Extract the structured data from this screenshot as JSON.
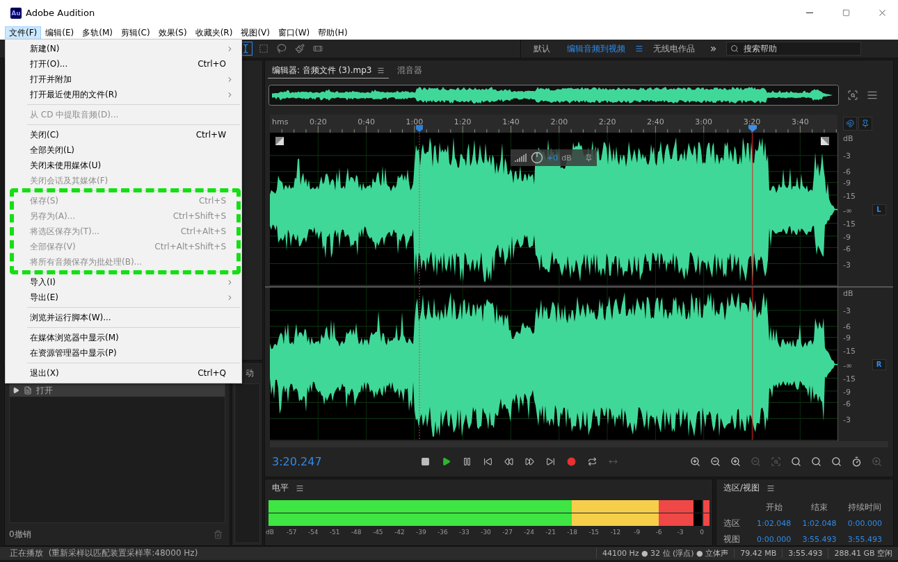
{
  "window": {
    "app_badge": "Au",
    "title": "Adobe Audition"
  },
  "menu_bar": [
    {
      "label": "文件(F)",
      "selected": true
    },
    {
      "label": "编辑(E)",
      "selected": false
    },
    {
      "label": "多轨(M)",
      "selected": false
    },
    {
      "label": "剪辑(C)",
      "selected": false
    },
    {
      "label": "效果(S)",
      "selected": false
    },
    {
      "label": "收藏夹(R)",
      "selected": false
    },
    {
      "label": "视图(V)",
      "selected": false
    },
    {
      "label": "窗口(W)",
      "selected": false
    },
    {
      "label": "帮助(H)",
      "selected": false
    }
  ],
  "file_menu": {
    "sections": [
      {
        "highlighted": false,
        "items": [
          {
            "label": "新建(N)",
            "submenu": true,
            "disabled": false
          },
          {
            "label": "打开(O)...",
            "shortcut": "Ctrl+O",
            "submenu": false,
            "disabled": false
          },
          {
            "label": "打开并附加",
            "submenu": true,
            "disabled": false
          },
          {
            "label": "打开最近使用的文件(R)",
            "submenu": true,
            "disabled": false
          }
        ]
      },
      {
        "highlighted": false,
        "items": [
          {
            "label": "从 CD 中提取音频(D)...",
            "submenu": false,
            "disabled": true
          }
        ]
      },
      {
        "highlighted": false,
        "items": [
          {
            "label": "关闭(C)",
            "shortcut": "Ctrl+W",
            "submenu": false,
            "disabled": false
          },
          {
            "label": "全部关闭(L)",
            "submenu": false,
            "disabled": false
          },
          {
            "label": "关闭未使用媒体(U)",
            "submenu": false,
            "disabled": false
          },
          {
            "label": "关闭会话及其媒体(F)",
            "submenu": false,
            "disabled": true
          }
        ]
      },
      {
        "highlighted": true,
        "items": [
          {
            "label": "保存(S)",
            "shortcut": "Ctrl+S",
            "submenu": false,
            "disabled": true
          },
          {
            "label": "另存为(A)...",
            "shortcut": "Ctrl+Shift+S",
            "submenu": false,
            "disabled": true
          },
          {
            "label": "将选区保存为(T)...",
            "shortcut": "Ctrl+Alt+S",
            "submenu": false,
            "disabled": true
          },
          {
            "label": "全部保存(V)",
            "shortcut": "Ctrl+Alt+Shift+S",
            "submenu": false,
            "disabled": true
          },
          {
            "label": "将所有音频保存为批处理(B)...",
            "submenu": false,
            "disabled": true
          }
        ]
      },
      {
        "highlighted": false,
        "items": [
          {
            "label": "导入(I)",
            "submenu": true,
            "disabled": false
          },
          {
            "label": "导出(E)",
            "submenu": true,
            "disabled": false
          }
        ]
      },
      {
        "highlighted": false,
        "items": [
          {
            "label": "浏览并运行脚本(W)...",
            "submenu": false,
            "disabled": false
          }
        ]
      },
      {
        "highlighted": false,
        "items": [
          {
            "label": "在媒体浏览器中显示(M)",
            "submenu": false,
            "disabled": false
          },
          {
            "label": "在资源管理器中显示(P)",
            "submenu": false,
            "disabled": false
          }
        ]
      },
      {
        "highlighted": false,
        "items": [
          {
            "label": "退出(X)",
            "shortcut": "Ctrl+Q",
            "submenu": false,
            "disabled": false
          }
        ]
      }
    ]
  },
  "tools": [
    {
      "kind": "time-selection",
      "selected": true
    },
    {
      "kind": "marquee",
      "selected": false
    },
    {
      "kind": "lasso",
      "selected": false
    },
    {
      "kind": "brush",
      "selected": false
    },
    {
      "kind": "healing",
      "selected": false
    }
  ],
  "workspaces": [
    {
      "label": "默认",
      "selected": false
    },
    {
      "label": "编辑音频到视频",
      "selected": true
    },
    {
      "label": "无线电作品",
      "selected": false
    }
  ],
  "more_workspaces": "»",
  "search": {
    "placeholder": "搜索帮助"
  },
  "editor_tabs": [
    {
      "label": "编辑器: 音频文件 (3).mp3",
      "selected": true
    },
    {
      "label": "混音器",
      "selected": false
    }
  ],
  "ruler": {
    "unit": "hms",
    "labels": [
      "0:20",
      "0:40",
      "1:00",
      "1:20",
      "1:40",
      "2:00",
      "2:20",
      "2:40",
      "3:00",
      "3:20",
      "3:40"
    ]
  },
  "channels": [
    {
      "label": "L",
      "scale": [
        "dB",
        "-3",
        "-6",
        "-9",
        "-15",
        "-∞",
        "-15",
        "-9",
        "-6",
        "-3"
      ]
    },
    {
      "label": "R",
      "scale": [
        "dB",
        "-3",
        "-6",
        "-9",
        "-15",
        "-∞",
        "-15",
        "-9",
        "-6",
        "-3"
      ]
    }
  ],
  "hud": {
    "value": "+0",
    "unit": "dB"
  },
  "time_display": "3:20.247",
  "transport": [
    {
      "kind": "stop"
    },
    {
      "kind": "play"
    },
    {
      "kind": "pause"
    },
    {
      "kind": "to-start"
    },
    {
      "kind": "rewind"
    },
    {
      "kind": "fast-forward"
    },
    {
      "kind": "to-end"
    },
    {
      "kind": "record"
    },
    {
      "kind": "loop"
    },
    {
      "kind": "skip-selection"
    }
  ],
  "zoom_tools": [
    {
      "kind": "zoom-in-amplitude",
      "disabled": false
    },
    {
      "kind": "zoom-out-amplitude",
      "disabled": false
    },
    {
      "kind": "zoom-in-time",
      "disabled": false
    },
    {
      "kind": "zoom-out-time",
      "disabled": true
    },
    {
      "kind": "zoom-out-full",
      "disabled": true
    },
    {
      "kind": "zoom-selection-in",
      "disabled": false
    },
    {
      "kind": "zoom-selection-out",
      "disabled": false
    },
    {
      "kind": "zoom-to-selection",
      "disabled": false
    },
    {
      "kind": "zoom-playhead",
      "disabled": false
    },
    {
      "kind": "zoom-reset",
      "disabled": true
    }
  ],
  "level_panel": {
    "title": "电平",
    "meters": [
      {
        "level": 0.98
      },
      {
        "level": 0.98
      }
    ],
    "scale": [
      "dB",
      "-57",
      "-54",
      "-51",
      "-48",
      "-45",
      "-42",
      "-39",
      "-36",
      "-33",
      "-30",
      "-27",
      "-24",
      "-21",
      "-18",
      "-15",
      "-12",
      "-9",
      "-6",
      "-3",
      "0"
    ]
  },
  "selection_panel": {
    "title": "选区/视图",
    "columns": [
      "开始",
      "结束",
      "持续时间"
    ],
    "rows": [
      {
        "label": "选区",
        "values": [
          "1:02.048",
          "1:02.048",
          "0:00.000"
        ]
      },
      {
        "label": "视图",
        "values": [
          "0:00.000",
          "3:55.493",
          "3:55.493"
        ]
      }
    ]
  },
  "history_panel": {
    "items": [
      {
        "label": "打开",
        "selected": true
      }
    ],
    "undo_count": "0撤销"
  },
  "side_tab": "动",
  "status_bar": {
    "message": "正在播放  (重新采样以匹配装置采样率:48000 Hz)",
    "cells": [
      "44100 Hz ● 32 位 (浮点) ● 立体声",
      "79.42 MB",
      "3:55.493",
      "288.41 GB 空闲"
    ]
  }
}
